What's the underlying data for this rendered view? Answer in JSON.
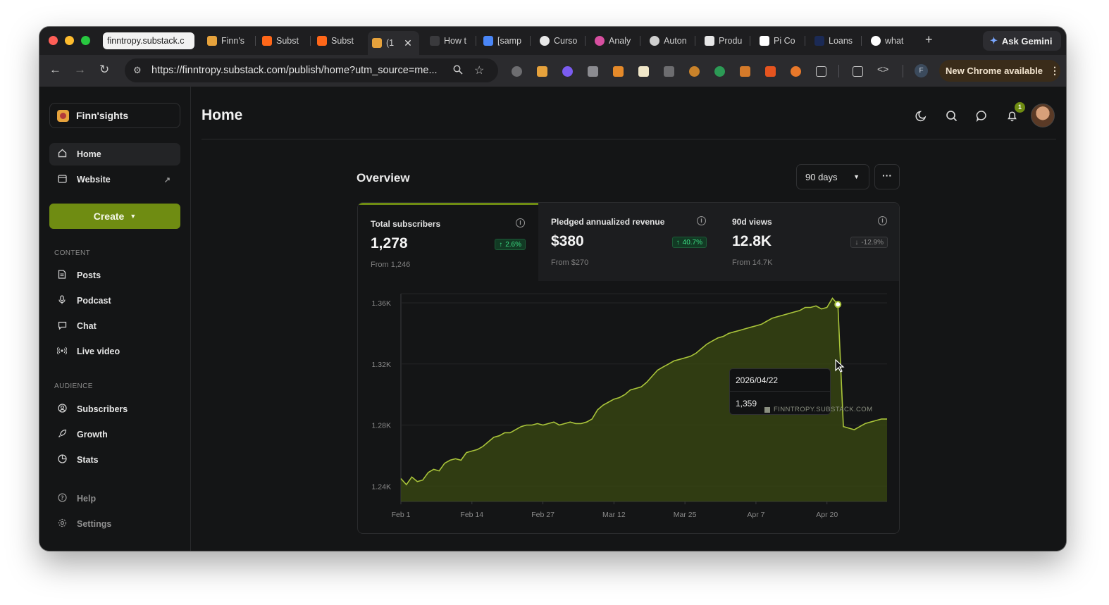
{
  "browser": {
    "tabs": [
      {
        "label": "finntropy.substack.c",
        "favicon": "#ffffff"
      },
      {
        "label": "Finn's",
        "favicon": "#e6a23c"
      },
      {
        "label": "Subst",
        "favicon": "#ff6719"
      },
      {
        "label": "Subst",
        "favicon": "#ff6719"
      },
      {
        "label": "(1",
        "favicon": "#e6a23c"
      },
      {
        "label": "How t",
        "favicon": "#2b2b2e"
      },
      {
        "label": "[samp",
        "favicon": "#4a86f7"
      },
      {
        "label": "Curso",
        "favicon": "#2b2b2e"
      },
      {
        "label": "Analy",
        "favicon": "#d74fa0"
      },
      {
        "label": "Auton",
        "favicon": "#cfcfcf"
      },
      {
        "label": "Produ",
        "favicon": "#e7e7e7"
      },
      {
        "label": "Pi Co",
        "favicon": "#111111"
      },
      {
        "label": "Loans",
        "favicon": "#1b2a55"
      },
      {
        "label": "what",
        "favicon": "#4a86f7"
      }
    ],
    "new_tab": "+",
    "ask_gemini": "Ask Gemini",
    "url": "https://finntropy.substack.com/publish/home?utm_source=me...",
    "new_chrome": "New Chrome available",
    "profile_initial": "F"
  },
  "sidebar": {
    "publication": "Finn'sights",
    "nav_top": [
      {
        "label": "Home",
        "icon": "home-icon"
      },
      {
        "label": "Website",
        "icon": "browser-icon",
        "ext": "↗"
      }
    ],
    "create_label": "Create",
    "content_section": "CONTENT",
    "content_items": [
      {
        "label": "Posts",
        "icon": "document-icon"
      },
      {
        "label": "Podcast",
        "icon": "microphone-icon"
      },
      {
        "label": "Chat",
        "icon": "chat-bubble-icon"
      },
      {
        "label": "Live video",
        "icon": "broadcast-icon"
      }
    ],
    "audience_section": "AUDIENCE",
    "audience_items": [
      {
        "label": "Subscribers",
        "icon": "user-circle-icon"
      },
      {
        "label": "Growth",
        "icon": "rocket-icon"
      },
      {
        "label": "Stats",
        "icon": "pie-chart-icon"
      }
    ],
    "footer_items": [
      {
        "label": "Help",
        "icon": "help-icon"
      },
      {
        "label": "Settings",
        "icon": "gear-icon"
      }
    ]
  },
  "header": {
    "title": "Home",
    "notification_count": "1"
  },
  "overview": {
    "title": "Overview",
    "range": "90 days",
    "more": "···",
    "metrics": [
      {
        "label": "Total subscribers",
        "value": "1,278",
        "change": "2.6%",
        "direction": "up",
        "from": "From 1,246"
      },
      {
        "label": "Pledged annualized revenue",
        "value": "$380",
        "change": "40.7%",
        "direction": "up",
        "from": "From $270"
      },
      {
        "label": "90d views",
        "value": "12.8K",
        "change": "-12.9%",
        "direction": "down",
        "from": "From 14.7K"
      }
    ]
  },
  "tooltip": {
    "date": "2026/04/22",
    "value": "1,359"
  },
  "watermark": "FINNTROPY.SUBSTACK.COM",
  "colors": {
    "accent": "#6f8c12",
    "line": "#a9c43a",
    "fill": "#3a4a12",
    "up": "#3ddc84"
  },
  "chart_data": {
    "type": "area",
    "ylim": [
      1230,
      1366
    ],
    "y_ticks": [
      "1.24K",
      "1.28K",
      "1.32K",
      "1.36K"
    ],
    "y_tick_values": [
      1240,
      1280,
      1320,
      1360
    ],
    "x_ticks": [
      "Feb 1",
      "Feb 14",
      "Feb 27",
      "Mar 12",
      "Mar 25",
      "Apr 7",
      "Apr 20"
    ],
    "xlim": [
      0,
      89
    ],
    "x_tick_positions": [
      0,
      13,
      26,
      39,
      52,
      65,
      78
    ],
    "series": [
      {
        "values": [
          1245,
          1241,
          1246,
          1243,
          1244,
          1249,
          1251,
          1250,
          1255,
          1257,
          1258,
          1257,
          1262,
          1263,
          1264,
          1266,
          1269,
          1272,
          1273,
          1275,
          1275,
          1277,
          1279,
          1280,
          1280,
          1281,
          1280,
          1281,
          1282,
          1280,
          1281,
          1282,
          1281,
          1281,
          1282,
          1284,
          1290,
          1293,
          1295,
          1297,
          1298,
          1300,
          1303,
          1304,
          1305,
          1308,
          1312,
          1316,
          1318,
          1320,
          1322,
          1323,
          1324,
          1325,
          1327,
          1330,
          1333,
          1335,
          1337,
          1338,
          1340,
          1341,
          1342,
          1343,
          1344,
          1345,
          1346,
          1348,
          1350,
          1351,
          1352,
          1353,
          1354,
          1355,
          1357,
          1357,
          1358,
          1356,
          1357,
          1363,
          1359,
          1279,
          1278,
          1277,
          1279,
          1281,
          1282,
          1283,
          1284,
          1284
        ]
      }
    ],
    "highlight": {
      "x": 80,
      "value": 1359,
      "label": "2026/04/22"
    }
  }
}
